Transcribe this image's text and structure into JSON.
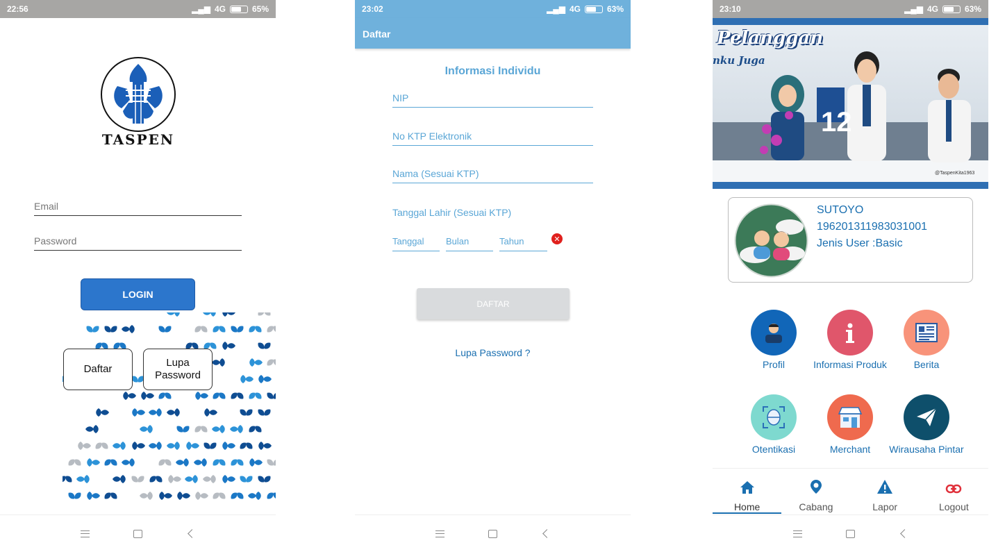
{
  "screen1": {
    "status": {
      "time": "22:56",
      "network": "4G",
      "battery": "65%",
      "battery_level": 0.65,
      "bg": "#a7a6a4"
    },
    "logo_text": "TASPEN",
    "email_placeholder": "Email",
    "password_placeholder": "Password",
    "login_label": "LOGIN",
    "daftar_label": "Daftar",
    "lupa_label_line1": "Lupa",
    "lupa_label_line2": "Password"
  },
  "screen2": {
    "status": {
      "time": "23:02",
      "network": "4G",
      "battery": "63%",
      "battery_level": 0.63,
      "bg": "#6fb1dc"
    },
    "appbar_title": "Daftar",
    "section_title": "Informasi Individu",
    "nip_placeholder": "NIP",
    "ktp_placeholder": "No KTP Elektronik",
    "nama_placeholder": "Nama (Sesuai KTP)",
    "tanggal_lahir_label": "Tanggal Lahir (Sesuai KTP)",
    "tanggal_placeholder": "Tanggal",
    "bulan_placeholder": "Bulan",
    "tahun_placeholder": "Tahun",
    "daftar_button": "DAFTAR",
    "forgot_link": "Lupa Password ?"
  },
  "screen3": {
    "status": {
      "time": "23:10",
      "network": "4G",
      "battery": "63%",
      "battery_level": 0.63,
      "bg": "#a7a6a4"
    },
    "banner_title": "Pelanggan",
    "banner_sub": "nku Juga",
    "banner_counter": "12",
    "banner_footer": "@TaspenKita1963",
    "user_name": "SUTOYO",
    "user_nip": "196201311983031001",
    "user_type": "Jenis User :Basic",
    "menu": [
      {
        "label": "Profil",
        "icon": "person-icon",
        "color": "#1166b8"
      },
      {
        "label": "Informasi Produk",
        "icon": "info-icon",
        "color": "#e0566b"
      },
      {
        "label": "Berita",
        "icon": "newspaper-icon",
        "color": "#f8937a"
      },
      {
        "label": "Otentikasi",
        "icon": "face-scan-icon",
        "color": "#7ed9cf"
      },
      {
        "label": "Merchant",
        "icon": "store-icon",
        "color": "#ef6a4e"
      },
      {
        "label": "Wirausaha Pintar",
        "icon": "paper-plane-icon",
        "color": "#0e4f6b"
      }
    ],
    "bottom_nav": [
      {
        "label": "Home",
        "icon": "home-icon"
      },
      {
        "label": "Cabang",
        "icon": "location-pin-icon"
      },
      {
        "label": "Lapor",
        "icon": "warning-icon"
      },
      {
        "label": "Logout",
        "icon": "link-icon"
      }
    ]
  }
}
